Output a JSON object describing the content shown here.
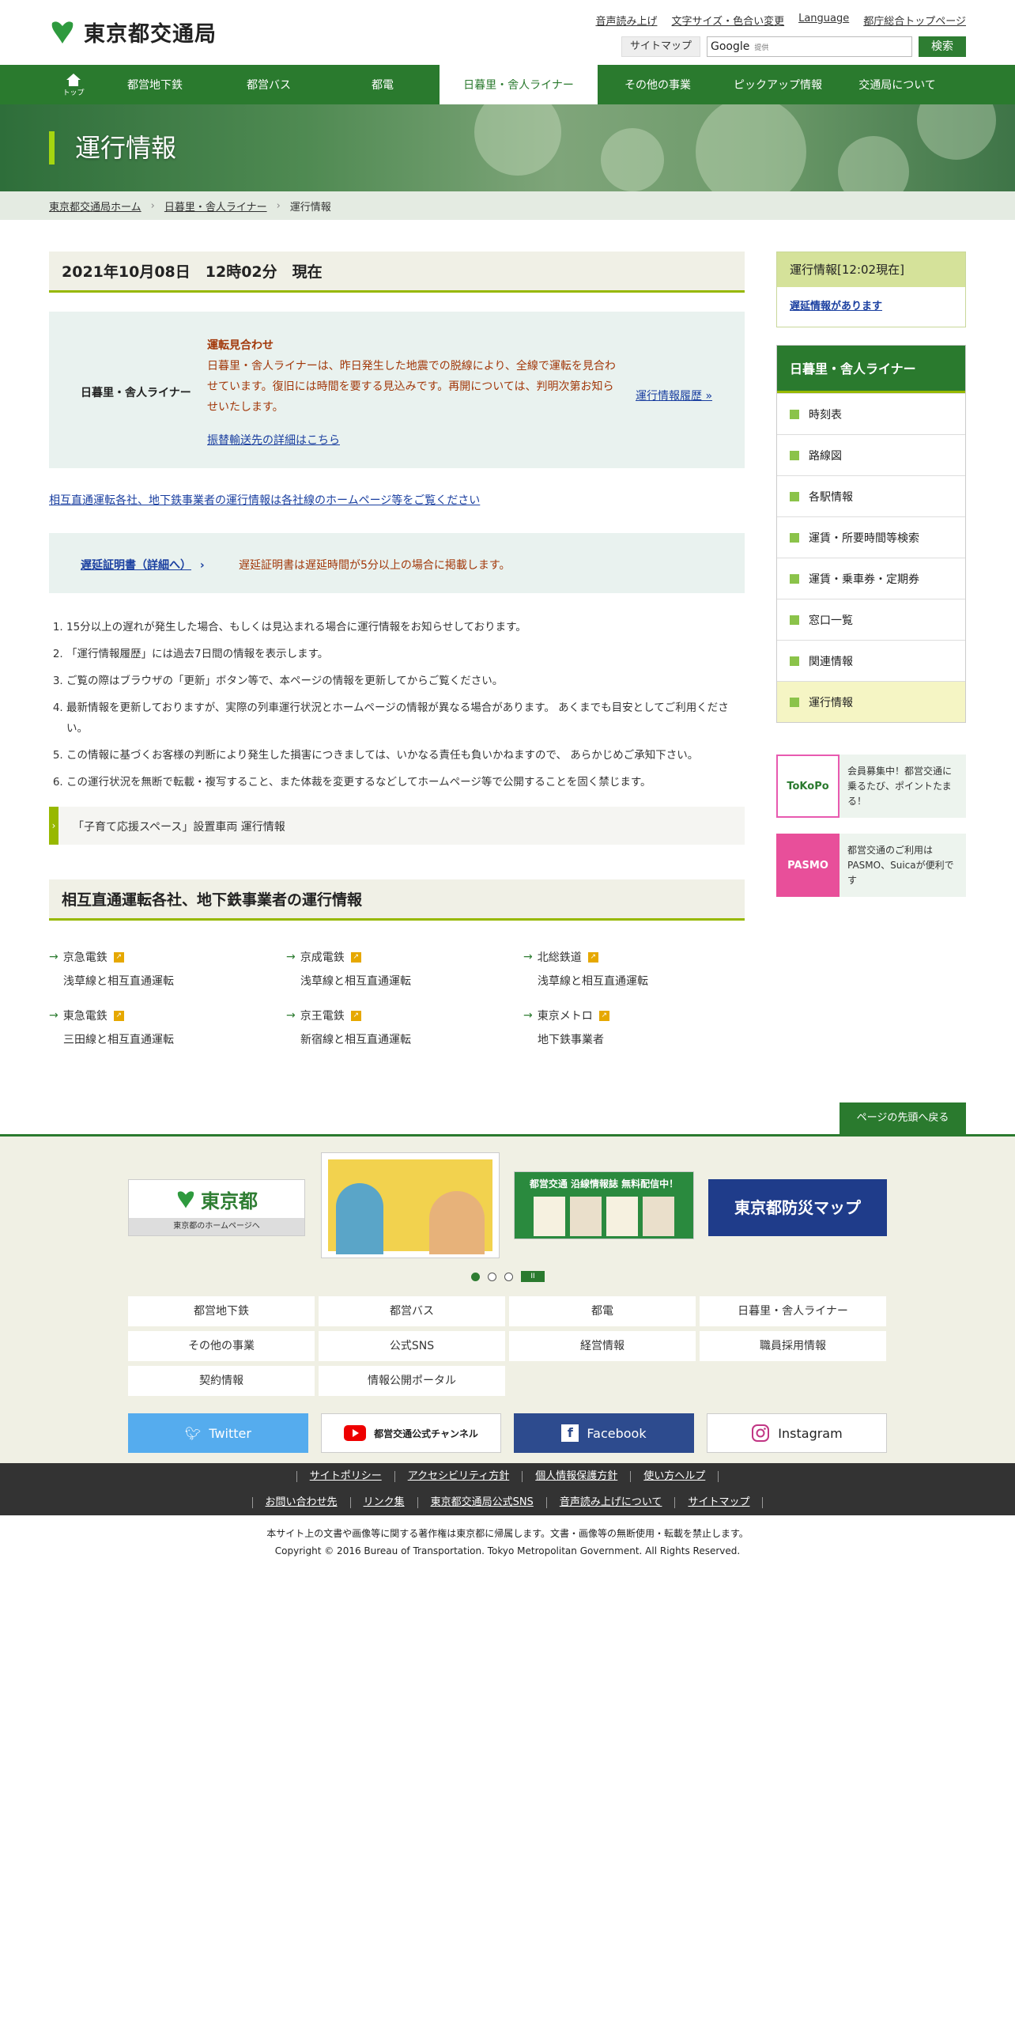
{
  "header": {
    "logo_text": "東京都交通局",
    "top_links": [
      "音声読み上げ",
      "文字サイズ・色合い変更",
      "Language",
      "都庁総合トップページ"
    ],
    "sitemap": "サイトマップ",
    "search_brand": "Google",
    "search_sub": "提供",
    "search_button": "検索"
  },
  "nav": {
    "home_label": "トップ",
    "items": [
      "都営地下鉄",
      "都営バス",
      "都電",
      "日暮里・舎人ライナー",
      "その他の事業",
      "ピックアップ情報",
      "交通局について"
    ],
    "active_index": 3
  },
  "hero": {
    "title": "運行情報"
  },
  "breadcrumb": [
    "東京都交通局ホーム",
    "日暮里・舎人ライナー",
    "運行情報"
  ],
  "main": {
    "datetime": "2021年10月08日　12時02分　現在",
    "status": {
      "line": "日暮里・舎人ライナー",
      "heading": "運転見合わせ",
      "message": "日暮里・舎人ライナーは、昨日発生した地震での脱線により、全線で運転を見合わせています。復旧には時間を要する見込みです。再開については、判明次第お知らせいたします。",
      "alt_transport": "振替輸送先の詳細はこちら",
      "history": "運行情報履歴 »"
    },
    "mutual_link": "相互直通運転各社、地下鉄事業者の運行情報は各社線のホームページ等をご覧ください",
    "delay": {
      "link": "遅延証明書（詳細へ）",
      "text": "遅延証明書は遅延時間が5分以上の場合に掲載します。"
    },
    "notes": [
      "15分以上の遅れが発生した場合、もしくは見込まれる場合に運行情報をお知らせしております。",
      "「運行情報履歴」には過去7日間の情報を表示します。",
      "ご覧の際はブラウザの「更新」ボタン等で、本ページの情報を更新してからご覧ください。",
      "最新情報を更新しておりますが、実際の列車運行状況とホームページの情報が異なる場合があります。 あくまでも目安としてご利用ください。",
      "この情報に基づくお客様の判断により発生した損害につきましては、いかなる責任も負いかねますので、 あらかじめご承知下さい。",
      "この運行状況を無断で転載・複写すること、また体裁を変更するなどしてホームページ等で公開することを固く禁じます。"
    ],
    "kosodate": "「子育て応援スペース」設置車両 運行情報",
    "mutual_heading": "相互直通運転各社、地下鉄事業者の運行情報",
    "operators": [
      {
        "name": "京急電鉄",
        "line": "浅草線と相互直通運転"
      },
      {
        "name": "京成電鉄",
        "line": "浅草線と相互直通運転"
      },
      {
        "name": "北総鉄道",
        "line": "浅草線と相互直通運転"
      },
      {
        "name": "東急電鉄",
        "line": "三田線と相互直通運転"
      },
      {
        "name": "京王電鉄",
        "line": "新宿線と相互直通運転"
      },
      {
        "name": "東京メトロ",
        "line": "地下鉄事業者"
      }
    ]
  },
  "side": {
    "op_title": "運行情報[12:02現在]",
    "op_link": "遅延情報があります",
    "menu_title": "日暮里・舎人ライナー",
    "menu_items": [
      "時刻表",
      "路線図",
      "各駅情報",
      "運賃・所要時間等検索",
      "運賃・乗車券・定期券",
      "窓口一覧",
      "関連情報",
      "運行情報"
    ],
    "menu_active_index": 7,
    "banners": [
      {
        "img_label": "ToKoPo",
        "text": "会員募集中！都営交通に乗るたび、ポイントたまる！"
      },
      {
        "img_label": "PASMO",
        "text": "都営交通のご利用はPASMO、Suicaが便利です"
      }
    ]
  },
  "totop": "ページの先頭へ戻る",
  "footer": {
    "carousel": {
      "tokyo_name": "東京都",
      "tokyo_sub": "東京都のホームページへ",
      "line_info": "都営交通 沿線情報誌 無料配信中！",
      "bosai": "東京都防災マップ",
      "slides": 3,
      "active": 0,
      "pause": "II"
    },
    "grid": [
      "都営地下鉄",
      "都営バス",
      "都電",
      "日暮里・舎人ライナー",
      "その他の事業",
      "公式SNS",
      "経営情報",
      "職員採用情報",
      "契約情報",
      "情報公開ポータル"
    ],
    "social": {
      "twitter": "Twitter",
      "youtube": "都営交通公式チャンネル",
      "facebook": "Facebook",
      "instagram": "Instagram"
    },
    "links_row1": [
      "サイトポリシー",
      "アクセシビリティ方針",
      "個人情報保護方針",
      "使い方ヘルプ"
    ],
    "links_row2": [
      "お問い合わせ先",
      "リンク集",
      "東京都交通局公式SNS",
      "音声読み上げについて",
      "サイトマップ"
    ],
    "notice": "本サイト上の文書や画像等に関する著作権は東京都に帰属します。文書・画像等の無断使用・転載を禁止します。",
    "copyright": "Copyright © 2016 Bureau of Transportation. Tokyo Metropolitan Government. All Rights Reserved."
  },
  "colors": {
    "brand_green": "#2a7a2e",
    "accent_lime": "#97b800",
    "alert_text": "#a2380a",
    "link_blue": "#1a3fa0"
  }
}
